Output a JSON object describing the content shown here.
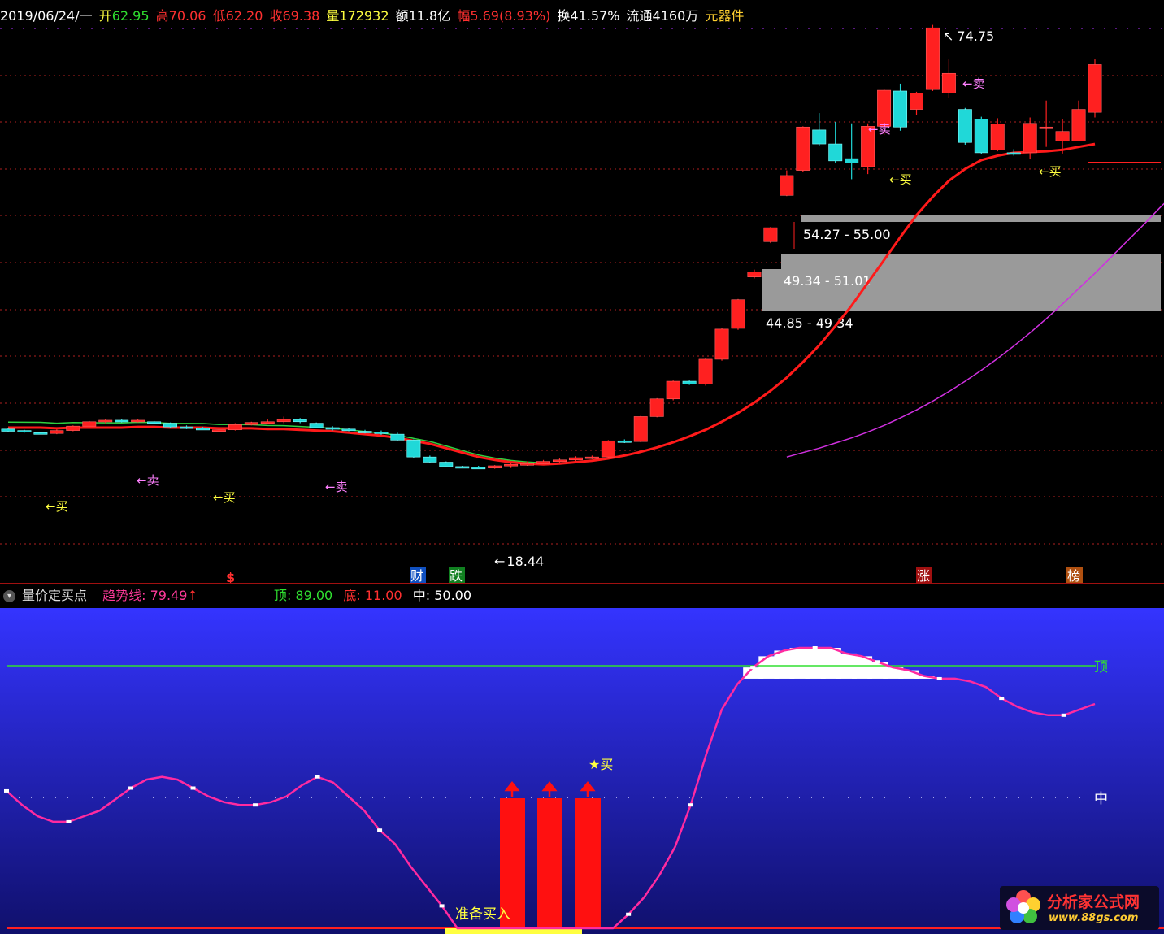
{
  "colors": {
    "up": "#ff2020",
    "down": "#20d8d8",
    "ma_fast": "#ff1a1a",
    "ma_slow": "#d030e0",
    "green_line": "#30d040",
    "yellow": "#ffff40",
    "panel_bg_top": "#3030ff",
    "panel_bg_bottom": "#10106a",
    "oscillator": "#ff2aa0"
  },
  "info_bar": {
    "date": "2019/06/24/一",
    "open_label": "开",
    "open": "62.95",
    "high_label": "高",
    "high": "70.06",
    "low_label": "低",
    "low": "62.20",
    "close_label": "收",
    "close": "69.38",
    "volume_label": "量",
    "volume": "172932",
    "amount_label": "额",
    "amount": "11.8亿",
    "change_label": "幅",
    "change": "5.69(8.93%)",
    "turnover_label": "换",
    "turnover": "41.57%",
    "float_label": "流通",
    "float": "4160万",
    "sector": "元器件"
  },
  "price_labels": {
    "high_mark": "74.75",
    "low_mark": "18.44"
  },
  "signals": {
    "buy": "买",
    "sell": "卖",
    "buy_arrow": "←买",
    "sell_arrow": "←卖"
  },
  "zones": [
    {
      "label": "54.27 - 55.00"
    },
    {
      "label": "49.34 - 51.01"
    },
    {
      "label": "44.85 - 49.34"
    }
  ],
  "event_tags": [
    {
      "text": "$",
      "color": "#ff3030"
    },
    {
      "text": "财",
      "color": "#3090ff"
    },
    {
      "text": "跌",
      "color": "#30d030"
    },
    {
      "text": "涨",
      "color": "#ff3030"
    },
    {
      "text": "榜",
      "color": "#ff8030"
    }
  ],
  "indicator": {
    "name": "量价定买点",
    "trend_label": "趋势线",
    "trend_value": "79.49",
    "trend_arrow": "↑",
    "top_label": "顶",
    "top_value": "89.00",
    "bottom_label": "底",
    "bottom_value": "11.00",
    "mid_label": "中",
    "mid_value": "50.00",
    "top_tag": "顶",
    "mid_tag": "中",
    "star_buy": "★买",
    "prepare_buy": "准备买入"
  },
  "logo": {
    "name": "分析家公式网",
    "url": "www.88gs.com"
  },
  "chart_data": {
    "type": "candlestick",
    "series": [
      {
        "name": "price",
        "ohlc": [
          [
            19.8,
            19.9,
            19.4,
            19.5
          ],
          [
            19.6,
            19.7,
            19.3,
            19.4
          ],
          [
            19.3,
            19.4,
            19.1,
            19.2
          ],
          [
            19.2,
            19.8,
            19.1,
            19.6
          ],
          [
            19.6,
            20.3,
            19.5,
            20.2
          ],
          [
            20.2,
            20.9,
            20.0,
            20.8
          ],
          [
            20.8,
            21.2,
            20.6,
            21.0
          ],
          [
            21.0,
            21.2,
            20.7,
            20.9
          ],
          [
            20.9,
            21.2,
            20.7,
            21.0
          ],
          [
            20.8,
            20.9,
            20.5,
            20.6
          ],
          [
            20.6,
            20.7,
            20.0,
            20.1
          ],
          [
            20.1,
            20.3,
            19.8,
            19.9
          ],
          [
            19.9,
            20.1,
            19.7,
            19.8
          ],
          [
            19.7,
            19.9,
            19.6,
            19.7
          ],
          [
            19.7,
            20.6,
            19.6,
            20.4
          ],
          [
            20.4,
            20.8,
            20.3,
            20.7
          ],
          [
            20.7,
            21.1,
            20.5,
            20.8
          ],
          [
            20.8,
            21.5,
            20.6,
            21.1
          ],
          [
            21.1,
            21.3,
            20.6,
            20.8
          ],
          [
            20.6,
            20.7,
            19.9,
            20.0
          ],
          [
            20.0,
            20.2,
            19.6,
            19.8
          ],
          [
            19.8,
            19.9,
            19.5,
            19.6
          ],
          [
            19.5,
            19.7,
            19.2,
            19.4
          ],
          [
            19.4,
            19.6,
            19.0,
            19.2
          ],
          [
            19.1,
            19.3,
            18.2,
            18.3
          ],
          [
            18.3,
            18.4,
            15.9,
            16.0
          ],
          [
            16.0,
            16.2,
            15.2,
            15.3
          ],
          [
            15.3,
            15.4,
            14.6,
            14.7
          ],
          [
            14.7,
            14.8,
            14.5,
            14.6
          ],
          [
            14.6,
            14.8,
            14.4,
            14.5
          ],
          [
            14.5,
            14.9,
            14.4,
            14.8
          ],
          [
            14.8,
            15.2,
            14.5,
            15.0
          ],
          [
            15.0,
            15.4,
            14.8,
            15.1
          ],
          [
            15.1,
            15.6,
            15.0,
            15.4
          ],
          [
            15.4,
            15.8,
            15.2,
            15.6
          ],
          [
            15.6,
            16.1,
            15.4,
            15.9
          ],
          [
            15.9,
            16.2,
            15.7,
            16.0
          ],
          [
            16.0,
            18.3,
            15.9,
            18.2
          ],
          [
            18.2,
            18.4,
            17.9,
            18.1
          ],
          [
            18.1,
            21.6,
            18.0,
            21.5
          ],
          [
            21.5,
            24.0,
            21.4,
            23.9
          ],
          [
            23.9,
            26.4,
            23.7,
            26.3
          ],
          [
            26.3,
            26.4,
            25.8,
            25.9
          ],
          [
            25.9,
            29.5,
            25.7,
            29.3
          ],
          [
            29.3,
            33.5,
            29.1,
            33.4
          ],
          [
            33.5,
            37.5,
            33.3,
            37.4
          ],
          [
            40.5,
            41.5,
            40.3,
            41.2
          ],
          [
            45.3,
            47.3,
            45.1,
            47.2
          ],
          [
            51.6,
            55.0,
            51.5,
            54.3
          ],
          [
            55.0,
            61.0,
            54.8,
            60.9
          ],
          [
            60.5,
            62.8,
            58.3,
            58.6
          ],
          [
            58.6,
            61.6,
            56.0,
            56.3
          ],
          [
            56.6,
            61.4,
            53.8,
            56.0
          ],
          [
            55.5,
            61.4,
            54.5,
            61.0
          ],
          [
            61.0,
            66.1,
            59.8,
            65.9
          ],
          [
            65.8,
            66.8,
            60.4,
            60.9
          ],
          [
            63.3,
            65.7,
            62.5,
            65.5
          ],
          [
            66.0,
            74.8,
            65.8,
            74.4
          ],
          [
            65.5,
            70.1,
            64.8,
            68.2
          ],
          [
            63.3,
            63.5,
            58.5,
            58.8
          ],
          [
            62.0,
            62.3,
            57.2,
            57.4
          ],
          [
            57.8,
            62.1,
            57.6,
            61.3
          ],
          [
            57.4,
            57.9,
            57.0,
            57.2
          ],
          [
            57.4,
            62.2,
            56.5,
            61.4
          ],
          [
            60.7,
            64.5,
            58.2,
            60.9
          ],
          [
            59.0,
            62.0,
            57.3,
            60.3
          ],
          [
            59.0,
            64.5,
            59.0,
            63.3
          ],
          [
            62.9,
            70.1,
            62.2,
            69.4
          ]
        ]
      },
      {
        "name": "ma_fast",
        "values": [
          20.0,
          20.0,
          20.0,
          19.9,
          20.0,
          20.0,
          20.0,
          20.0,
          20.1,
          20.1,
          20.0,
          20.0,
          20.0,
          19.9,
          19.9,
          19.9,
          19.8,
          19.8,
          19.7,
          19.6,
          19.5,
          19.3,
          19.1,
          18.9,
          18.6,
          18.2,
          17.8,
          17.2,
          16.6,
          16.0,
          15.6,
          15.3,
          15.1,
          15.0,
          15.1,
          15.3,
          15.5,
          15.8,
          16.2,
          16.7,
          17.3,
          18.0,
          18.8,
          19.7,
          20.8,
          22.0,
          23.4,
          25.0,
          26.8,
          28.9,
          31.2,
          33.8,
          36.6,
          39.7,
          42.8,
          45.9,
          48.9,
          51.4,
          53.6,
          55.2,
          56.4,
          57.0,
          57.4,
          57.5,
          57.6,
          57.8,
          58.2,
          58.6
        ]
      },
      {
        "name": "ma_slow",
        "values": [
          null,
          null,
          null,
          null,
          null,
          null,
          null,
          null,
          null,
          null,
          null,
          null,
          null,
          null,
          null,
          null,
          null,
          null,
          null,
          null,
          null,
          null,
          null,
          null,
          null,
          null,
          null,
          null,
          null,
          null,
          null,
          null,
          null,
          null,
          null,
          null,
          null,
          null,
          null,
          null,
          null,
          null,
          null,
          null,
          null,
          null,
          null,
          null,
          16.0,
          16.6,
          17.2,
          17.9,
          18.6,
          19.4,
          20.3,
          21.3,
          22.4,
          23.6,
          24.9,
          26.3,
          27.8,
          29.4,
          31.1,
          32.9,
          34.8,
          36.8,
          38.9,
          41.0,
          43.2,
          45.4,
          47.6,
          49.9,
          52.1,
          54.3,
          56.5,
          58.6
        ]
      },
      {
        "name": "oscillator",
        "values": [
          49,
          44,
          40,
          38,
          38,
          40,
          42,
          46,
          50,
          53,
          54,
          53,
          50,
          47,
          45,
          44,
          44,
          45,
          47,
          51,
          54,
          52,
          47,
          42,
          35,
          30,
          22,
          15,
          8,
          0,
          0,
          0,
          0,
          0,
          0,
          0,
          0,
          0,
          0,
          0,
          5,
          11,
          19,
          29,
          44,
          62,
          78,
          87,
          93,
          97,
          99,
          100,
          100,
          100,
          98,
          97,
          95,
          93,
          92,
          90,
          89,
          89,
          88,
          86,
          82,
          79,
          77,
          76,
          76,
          78,
          80
        ]
      }
    ],
    "ylim": [
      12,
      78
    ],
    "osc_ylim": [
      0,
      100
    ],
    "osc_levels": {
      "top": 89,
      "mid": 50,
      "bottom": 11
    }
  }
}
